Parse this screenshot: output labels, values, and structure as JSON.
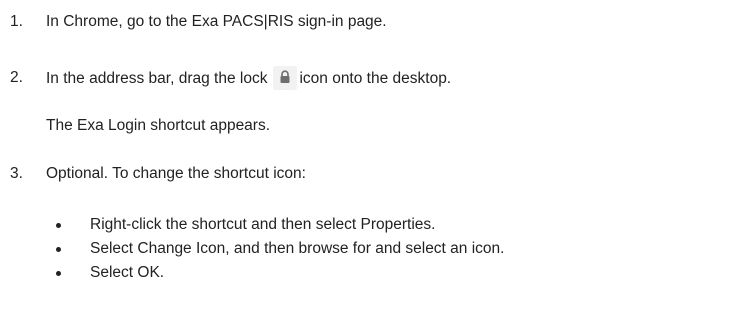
{
  "steps": [
    {
      "number": "1.",
      "text": "In Chrome, go to the Exa PACS|RIS sign-in page."
    },
    {
      "number": "2.",
      "text_before": "In the address bar, drag the lock",
      "icon": "lock-icon",
      "text_after": "icon onto the desktop.",
      "note": "The Exa Login shortcut appears."
    },
    {
      "number": "3.",
      "text": "Optional. To change the shortcut icon:",
      "bullets": [
        "Right-click the shortcut and then select Properties.",
        "Select Change Icon, and then browse for and select an icon.",
        "Select OK."
      ]
    }
  ],
  "colors": {
    "text": "#222222",
    "icon_background": "#f2f2f2",
    "icon": "#6e6e6e"
  }
}
